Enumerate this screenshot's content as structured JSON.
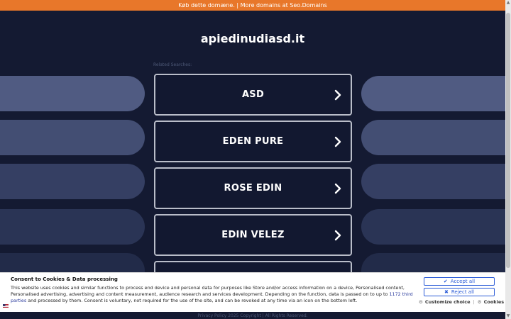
{
  "banner": {
    "left_text": "Køb dette domæne.",
    "separator": "|",
    "right_text": "More domains at Seo.Domains"
  },
  "domain": "apiedinudiasd.it",
  "related_label": "Related Searches:",
  "searches": [
    {
      "label": "ASD"
    },
    {
      "label": "EDEN PURE"
    },
    {
      "label": "ROSE EDIN"
    },
    {
      "label": "EDIN VELEZ"
    },
    {
      "label": ""
    }
  ],
  "icons": {
    "chevron": "chevron-right-icon",
    "check": "check-icon",
    "close": "close-icon",
    "gear": "gear-icon",
    "flag": "us-flag-icon"
  },
  "colors": {
    "banner": "#e8772a",
    "page_bg": "#141a32",
    "button_border": "#b9bdc9",
    "accent": "#2a5bd7"
  },
  "cookie": {
    "title": "Consent to Cookies & Data processing",
    "text_before_link": "This website uses cookies and similar functions to process end device and personal data for purposes like Store and/or access information on a device, Personalised content, Personalised advertising, advertising and content measurement, audience research and services development. Depending on the function, data is passed on to up to ",
    "link_text": "1172 third parties",
    "text_after_link": " and processed by them. Consent is voluntary, not required for the use of the site, and can be revoked at any time via an icon on the bottom left.",
    "accept_label": "Accept all",
    "reject_label": "Reject all",
    "customize_label": "Customize choice",
    "cookies_label": "Cookies",
    "link_separator": "|"
  },
  "footer": {
    "privacy": "Privacy Policy",
    "copyright": "2025 Copyright | All Rights Reserved."
  }
}
